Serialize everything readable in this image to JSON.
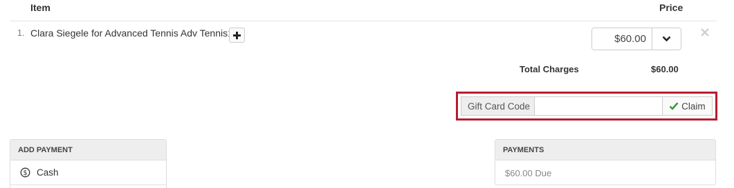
{
  "table": {
    "header_item": "Item",
    "header_price": "Price",
    "rows": [
      {
        "number": "1.",
        "description": "Clara Siegele for Advanced Tennis Adv Tennis1",
        "price": "$60.00"
      }
    ]
  },
  "totals": {
    "label": "Total Charges",
    "value": "$60.00"
  },
  "gift_card": {
    "label": "Gift Card Code",
    "input_value": "",
    "claim_label": "Claim"
  },
  "add_payment": {
    "title": "ADD PAYMENT",
    "methods": [
      {
        "label": "Cash",
        "icon": "dollar-circle-icon"
      }
    ]
  },
  "payments": {
    "title": "PAYMENTS",
    "due_text": "$60.00 Due"
  },
  "colors": {
    "highlight_border": "#b71c2f",
    "check_green": "#3a9a3a",
    "panel_header_bg": "#eeeeee"
  }
}
